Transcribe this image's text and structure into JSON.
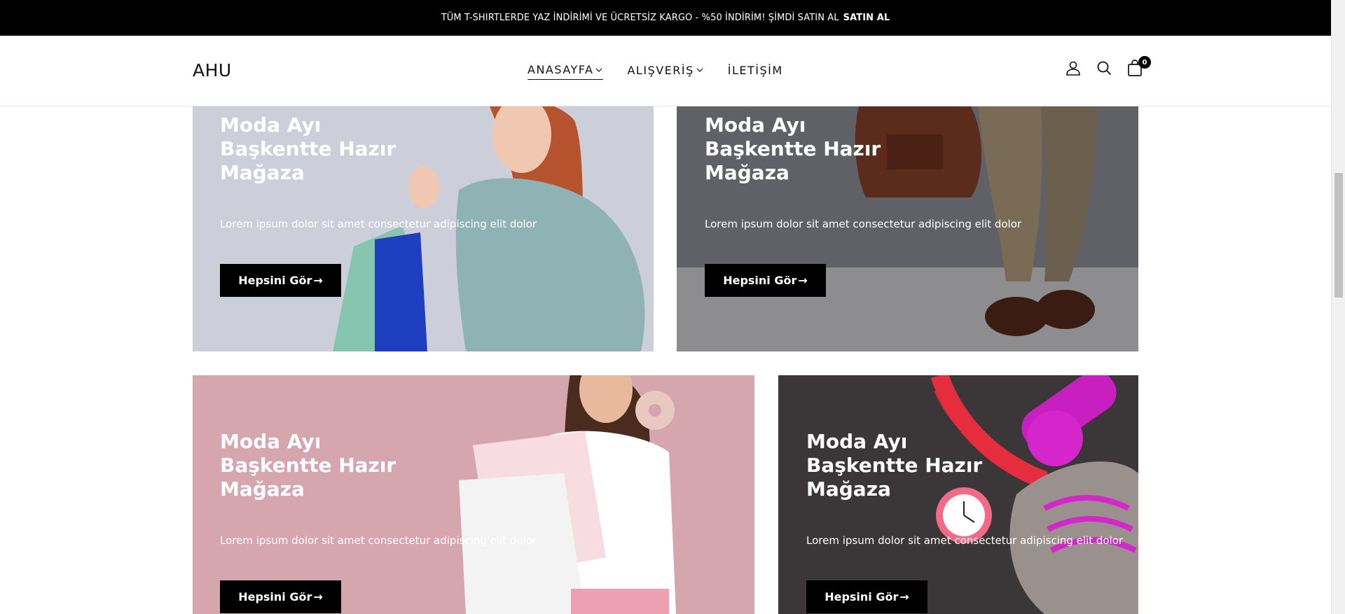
{
  "announcement": {
    "text": "TÜM T-SHIRTLERDE YAZ İNDİRİMİ VE ÜCRETSİZ KARGO - %50 İNDİRİM! ŞİMDİ SATIN AL",
    "cta": "SATIN AL"
  },
  "header": {
    "logo": "AHU",
    "nav": [
      {
        "label": "ANASAYFA"
      },
      {
        "label": "ALIŞVERİŞ"
      },
      {
        "label": "İLETİŞİM"
      }
    ],
    "cart_count": "0"
  },
  "banners": [
    {
      "title": "Moda Ayı\nBaşkentte Hazır\nMağaza",
      "description": "Lorem ipsum dolor sit amet consectetur adipiscing elit dolor",
      "button": "Hepsini Gör",
      "arrow": "→"
    },
    {
      "title": "Moda Ayı\nBaşkentte Hazır\nMağaza",
      "description": "Lorem ipsum dolor sit amet consectetur adipiscing elit dolor",
      "button": "Hepsini Gör",
      "arrow": "→"
    },
    {
      "title": "Moda Ayı\nBaşkentte Hazır\nMağaza",
      "description": "Lorem ipsum dolor sit amet consectetur adipiscing elit dolor",
      "button": "Hepsini Gör",
      "arrow": "→"
    },
    {
      "title": "Moda Ayı\nBaşkentte Hazır\nMağaza",
      "description": "Lorem ipsum dolor sit amet consectetur adipiscing elit dolor",
      "button": "Hepsini Gör",
      "arrow": "→"
    }
  ],
  "colors": {
    "banner_1_bg": "#c9cbd6",
    "banner_2_bg": "#5e6066",
    "banner_3_bg": "#d7a6ae",
    "banner_4_bg": "#3a3536"
  }
}
